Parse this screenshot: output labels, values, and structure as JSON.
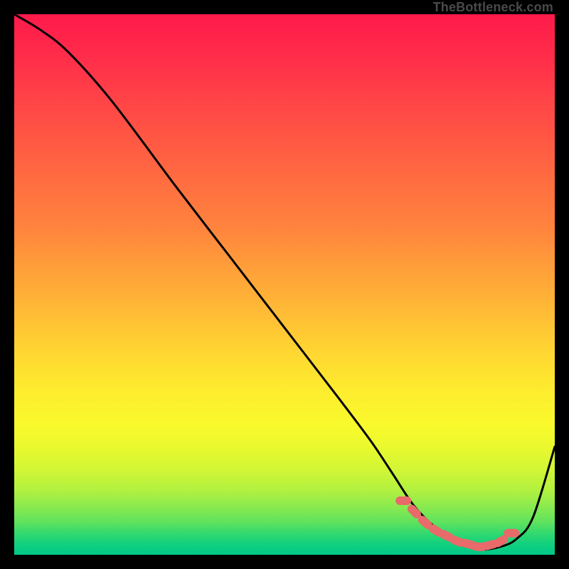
{
  "attribution": "TheBottleneck.com",
  "colors": {
    "background": "#000000",
    "curve_stroke": "#000000",
    "marker_fill": "#e86a6a",
    "marker_stroke": "#e86a6a",
    "gradient_top": "#ff1a4b",
    "gradient_bottom": "#00c888"
  },
  "chart_data": {
    "type": "line",
    "title": "",
    "xlabel": "",
    "ylabel": "",
    "xlim": [
      0,
      100
    ],
    "ylim": [
      0,
      100
    ],
    "grid": false,
    "legend": false,
    "series": [
      {
        "name": "curve",
        "type": "line",
        "x": [
          0,
          5,
          10,
          18,
          30,
          40,
          50,
          60,
          66,
          70,
          74,
          78,
          82,
          86,
          90,
          93,
          96,
          100
        ],
        "y": [
          100,
          97,
          93,
          84,
          68,
          55,
          42,
          29,
          21,
          15,
          9,
          5,
          2.5,
          1,
          1.5,
          3,
          7,
          20
        ]
      },
      {
        "name": "optimum-markers",
        "type": "scatter",
        "x": [
          72,
          74,
          76,
          78,
          80,
          82,
          84,
          86,
          88,
          90,
          92
        ],
        "y": [
          10,
          8,
          6,
          4.5,
          3.5,
          2.5,
          2,
          1.5,
          1.8,
          2.5,
          4
        ]
      }
    ],
    "annotations": []
  }
}
